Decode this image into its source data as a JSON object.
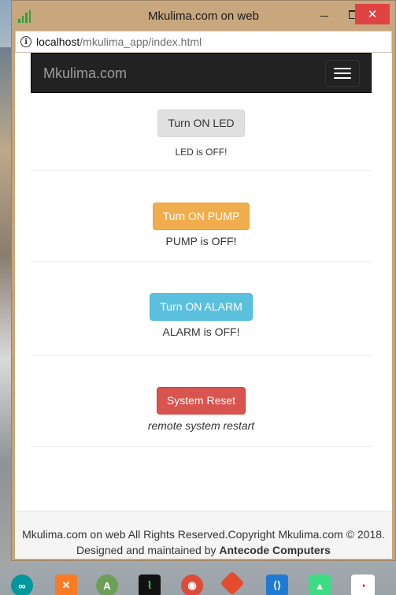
{
  "window": {
    "title": "Mkulima.com on web",
    "close_glyph": "✕"
  },
  "address": {
    "host": "localhost",
    "path": "/mkulima_app/index.html"
  },
  "navbar": {
    "brand": "Mkulima.com"
  },
  "controls": [
    {
      "button": "Turn ON LED",
      "status": "LED is OFF!"
    },
    {
      "button": "Turn ON PUMP",
      "status": "PUMP is OFF!"
    },
    {
      "button": "Turn ON ALARM",
      "status": "ALARM is OFF!"
    },
    {
      "button": "System Reset",
      "status": "remote system restart"
    }
  ],
  "footer": {
    "line1": "Mkulima.com on web All Rights Reserved.Copyright Mkulima.com © 2018.",
    "line2_prefix": "Designed and maintained by ",
    "line2_company": "Antecode Computers"
  },
  "colors": {
    "navbar": "#222222",
    "led_button": "#e0e0e0",
    "pump_button": "#f0ad4e",
    "alarm_button": "#5bc0de",
    "reset_button": "#d9534f"
  },
  "taskbar_icons": [
    "arduino-icon",
    "xampp-icon",
    "android-studio-icon",
    "monitor-app-icon",
    "chrome-icon",
    "git-icon",
    "vscode-icon",
    "android-device-icon",
    "app-icon"
  ]
}
